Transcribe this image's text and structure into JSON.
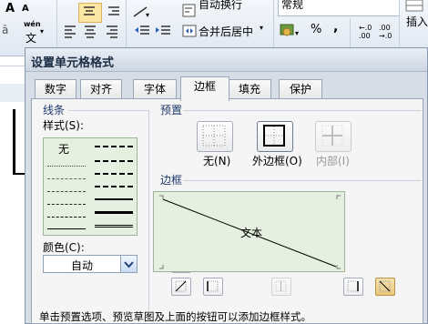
{
  "ribbon": {
    "font_glyph_a": "A",
    "font_glyph_a_small": "A",
    "wrap_text": "自动换行",
    "merge_center": "合并后居中",
    "number_format": "常规",
    "wen_icon_label": "wén",
    "wen_char": "文",
    "percent": "%",
    "comma": ",",
    "insert_label": "插入"
  },
  "dialog": {
    "title": "设置单元格格式",
    "tabs": [
      {
        "label": "数字"
      },
      {
        "label": "对齐"
      },
      {
        "label": "字体"
      },
      {
        "label": "边框",
        "active": true
      },
      {
        "label": "填充"
      },
      {
        "label": "保护"
      }
    ],
    "line_group": {
      "title": "线条",
      "style_label": "样式(S):",
      "none_label": "无",
      "color_label": "颜色(C):",
      "color_value": "自动"
    },
    "presets_group": {
      "title": "预置",
      "items": [
        {
          "label": "无(N)",
          "enabled": true
        },
        {
          "label": "外边框(O)",
          "enabled": true
        },
        {
          "label": "内部(I)",
          "enabled": false
        }
      ]
    },
    "border_group": {
      "title": "边框",
      "preview_text": "文本"
    },
    "hint": "单击预置选项、预览草图及上面的按钮可以添加边框样式。"
  }
}
